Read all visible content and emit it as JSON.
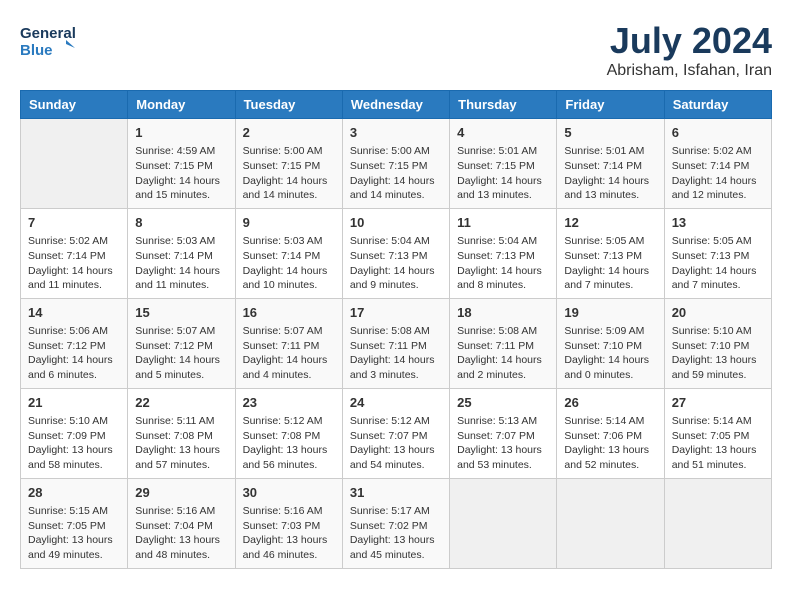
{
  "header": {
    "logo_line1": "General",
    "logo_line2": "Blue",
    "month": "July 2024",
    "location": "Abrisham, Isfahan, Iran"
  },
  "days_of_week": [
    "Sunday",
    "Monday",
    "Tuesday",
    "Wednesday",
    "Thursday",
    "Friday",
    "Saturday"
  ],
  "weeks": [
    [
      {
        "day": "",
        "info": ""
      },
      {
        "day": "1",
        "info": "Sunrise: 4:59 AM\nSunset: 7:15 PM\nDaylight: 14 hours\nand 15 minutes."
      },
      {
        "day": "2",
        "info": "Sunrise: 5:00 AM\nSunset: 7:15 PM\nDaylight: 14 hours\nand 14 minutes."
      },
      {
        "day": "3",
        "info": "Sunrise: 5:00 AM\nSunset: 7:15 PM\nDaylight: 14 hours\nand 14 minutes."
      },
      {
        "day": "4",
        "info": "Sunrise: 5:01 AM\nSunset: 7:15 PM\nDaylight: 14 hours\nand 13 minutes."
      },
      {
        "day": "5",
        "info": "Sunrise: 5:01 AM\nSunset: 7:14 PM\nDaylight: 14 hours\nand 13 minutes."
      },
      {
        "day": "6",
        "info": "Sunrise: 5:02 AM\nSunset: 7:14 PM\nDaylight: 14 hours\nand 12 minutes."
      }
    ],
    [
      {
        "day": "7",
        "info": "Sunrise: 5:02 AM\nSunset: 7:14 PM\nDaylight: 14 hours\nand 11 minutes."
      },
      {
        "day": "8",
        "info": "Sunrise: 5:03 AM\nSunset: 7:14 PM\nDaylight: 14 hours\nand 11 minutes."
      },
      {
        "day": "9",
        "info": "Sunrise: 5:03 AM\nSunset: 7:14 PM\nDaylight: 14 hours\nand 10 minutes."
      },
      {
        "day": "10",
        "info": "Sunrise: 5:04 AM\nSunset: 7:13 PM\nDaylight: 14 hours\nand 9 minutes."
      },
      {
        "day": "11",
        "info": "Sunrise: 5:04 AM\nSunset: 7:13 PM\nDaylight: 14 hours\nand 8 minutes."
      },
      {
        "day": "12",
        "info": "Sunrise: 5:05 AM\nSunset: 7:13 PM\nDaylight: 14 hours\nand 7 minutes."
      },
      {
        "day": "13",
        "info": "Sunrise: 5:05 AM\nSunset: 7:13 PM\nDaylight: 14 hours\nand 7 minutes."
      }
    ],
    [
      {
        "day": "14",
        "info": "Sunrise: 5:06 AM\nSunset: 7:12 PM\nDaylight: 14 hours\nand 6 minutes."
      },
      {
        "day": "15",
        "info": "Sunrise: 5:07 AM\nSunset: 7:12 PM\nDaylight: 14 hours\nand 5 minutes."
      },
      {
        "day": "16",
        "info": "Sunrise: 5:07 AM\nSunset: 7:11 PM\nDaylight: 14 hours\nand 4 minutes."
      },
      {
        "day": "17",
        "info": "Sunrise: 5:08 AM\nSunset: 7:11 PM\nDaylight: 14 hours\nand 3 minutes."
      },
      {
        "day": "18",
        "info": "Sunrise: 5:08 AM\nSunset: 7:11 PM\nDaylight: 14 hours\nand 2 minutes."
      },
      {
        "day": "19",
        "info": "Sunrise: 5:09 AM\nSunset: 7:10 PM\nDaylight: 14 hours\nand 0 minutes."
      },
      {
        "day": "20",
        "info": "Sunrise: 5:10 AM\nSunset: 7:10 PM\nDaylight: 13 hours\nand 59 minutes."
      }
    ],
    [
      {
        "day": "21",
        "info": "Sunrise: 5:10 AM\nSunset: 7:09 PM\nDaylight: 13 hours\nand 58 minutes."
      },
      {
        "day": "22",
        "info": "Sunrise: 5:11 AM\nSunset: 7:08 PM\nDaylight: 13 hours\nand 57 minutes."
      },
      {
        "day": "23",
        "info": "Sunrise: 5:12 AM\nSunset: 7:08 PM\nDaylight: 13 hours\nand 56 minutes."
      },
      {
        "day": "24",
        "info": "Sunrise: 5:12 AM\nSunset: 7:07 PM\nDaylight: 13 hours\nand 54 minutes."
      },
      {
        "day": "25",
        "info": "Sunrise: 5:13 AM\nSunset: 7:07 PM\nDaylight: 13 hours\nand 53 minutes."
      },
      {
        "day": "26",
        "info": "Sunrise: 5:14 AM\nSunset: 7:06 PM\nDaylight: 13 hours\nand 52 minutes."
      },
      {
        "day": "27",
        "info": "Sunrise: 5:14 AM\nSunset: 7:05 PM\nDaylight: 13 hours\nand 51 minutes."
      }
    ],
    [
      {
        "day": "28",
        "info": "Sunrise: 5:15 AM\nSunset: 7:05 PM\nDaylight: 13 hours\nand 49 minutes."
      },
      {
        "day": "29",
        "info": "Sunrise: 5:16 AM\nSunset: 7:04 PM\nDaylight: 13 hours\nand 48 minutes."
      },
      {
        "day": "30",
        "info": "Sunrise: 5:16 AM\nSunset: 7:03 PM\nDaylight: 13 hours\nand 46 minutes."
      },
      {
        "day": "31",
        "info": "Sunrise: 5:17 AM\nSunset: 7:02 PM\nDaylight: 13 hours\nand 45 minutes."
      },
      {
        "day": "",
        "info": ""
      },
      {
        "day": "",
        "info": ""
      },
      {
        "day": "",
        "info": ""
      }
    ]
  ]
}
